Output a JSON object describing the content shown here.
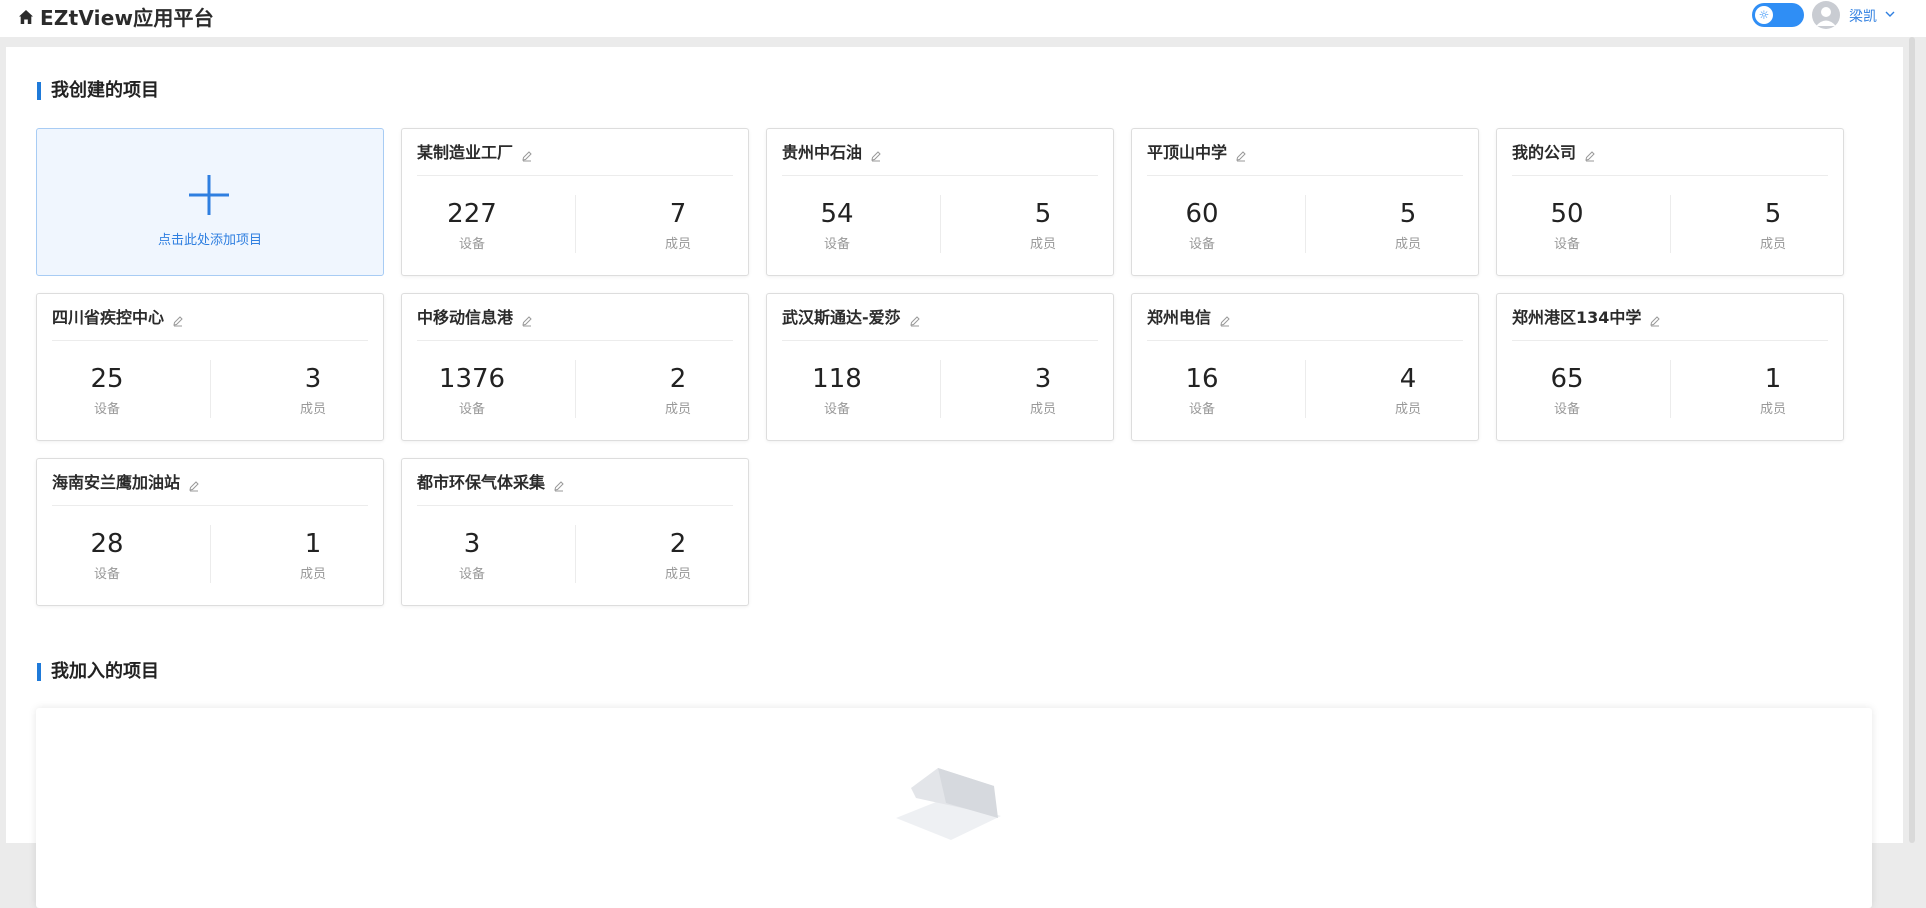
{
  "app": {
    "title": "EZtView应用平台"
  },
  "header": {
    "theme_icon": "sun-icon",
    "user_name": "梁凯"
  },
  "sections": {
    "created_title": "我创建的项目",
    "joined_title": "我加入的项目"
  },
  "add_project": {
    "label": "点击此处添加项目"
  },
  "labels": {
    "devices": "设备",
    "members": "成员"
  },
  "projects": [
    {
      "name": "某制造业工厂",
      "devices": "227",
      "members": "7"
    },
    {
      "name": "贵州中石油",
      "devices": "54",
      "members": "5"
    },
    {
      "name": "平顶山中学",
      "devices": "60",
      "members": "5"
    },
    {
      "name": "我的公司",
      "devices": "50",
      "members": "5"
    },
    {
      "name": "四川省疾控中心",
      "devices": "25",
      "members": "3"
    },
    {
      "name": "中移动信息港",
      "devices": "1376",
      "members": "2"
    },
    {
      "name": "武汉斯通达-爱莎",
      "devices": "118",
      "members": "3"
    },
    {
      "name": "郑州电信",
      "devices": "16",
      "members": "4"
    },
    {
      "name": "郑州港区134中学",
      "devices": "65",
      "members": "1"
    },
    {
      "name": "海南安兰鹰加油站",
      "devices": "28",
      "members": "1"
    },
    {
      "name": "都市环保气体采集",
      "devices": "3",
      "members": "2"
    }
  ],
  "colors": {
    "accent": "#2f8ef5",
    "brand_bar": "#1f7ad9"
  }
}
